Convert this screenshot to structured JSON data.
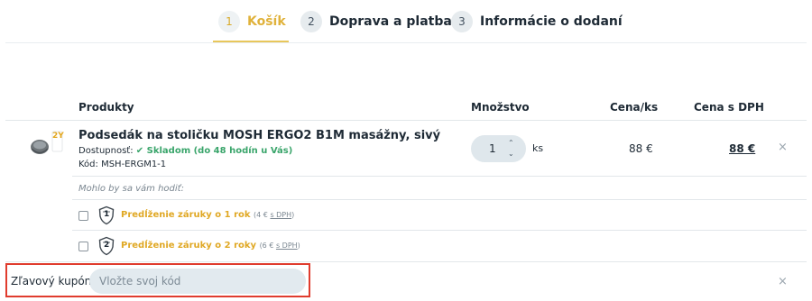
{
  "steps": [
    {
      "num": "1",
      "label": "Košík"
    },
    {
      "num": "2",
      "label": "Doprava a platba"
    },
    {
      "num": "3",
      "label": "Informácie o dodaní"
    }
  ],
  "table": {
    "headers": {
      "products": "Produkty",
      "quantity": "Množstvo",
      "unit_price": "Cena/ks",
      "price_vat": "Cena s DPH"
    }
  },
  "product": {
    "name": "Podsedák na stoličku MOSH ERGO2 B1M masážny, sivý",
    "availability_label": "Dostupnosť:",
    "availability_value": "✔ Skladom (do 48 hodín u Vás)",
    "code": "Kód: MSH-ERGM1-1",
    "quantity": "1",
    "unit": "ks",
    "unit_price": "88 €",
    "total_price": "88 €",
    "badge": "2Y"
  },
  "suggestions": {
    "title": "Mohlo by sa vám hodiť:",
    "items": [
      {
        "label": "Predĺženie záruky o 1 rok",
        "price": "(4 €",
        "vat": "s DPH",
        "close": ")",
        "icon_num": "1"
      },
      {
        "label": "Predĺženie záruky o 2 roky",
        "price": "(6 €",
        "vat": "s DPH",
        "close": ")",
        "icon_num": "2"
      }
    ]
  },
  "coupon": {
    "label": "Zľavový kupón",
    "placeholder": "Vložte svoj kód",
    "value": ""
  },
  "icons": {
    "remove": "close-icon",
    "quantity_up": "chevron-up-icon",
    "quantity_down": "chevron-down-icon",
    "warranty": "shield-icon"
  },
  "colors": {
    "active_step": "#e0b23b",
    "stock": "#3aa56b",
    "warranty_label": "#e0a824",
    "coupon_highlight": "#e03c2e"
  }
}
